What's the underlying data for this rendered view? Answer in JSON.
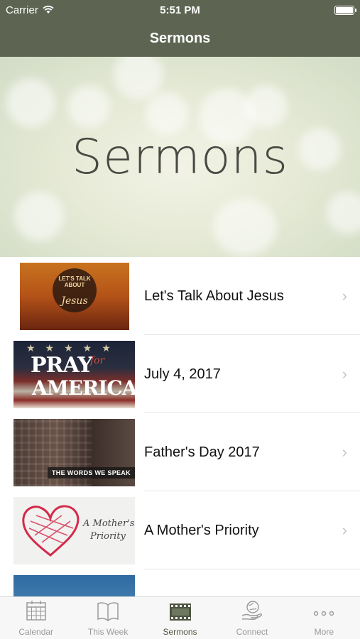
{
  "status_bar": {
    "carrier": "Carrier",
    "time": "5:51 PM"
  },
  "nav": {
    "title": "Sermons"
  },
  "banner": {
    "title": "Sermons"
  },
  "sermons": [
    {
      "title": "Let's Talk About Jesus",
      "thumb_text_1": "LET'S TALK ABOUT",
      "thumb_text_2": "Jesus"
    },
    {
      "title": "July 4, 2017",
      "thumb_text_1": "PRAY",
      "thumb_text_2": "for",
      "thumb_text_3": "AMERICA"
    },
    {
      "title": "Father's Day 2017",
      "thumb_text_1": "THE WORDS WE SPEAK"
    },
    {
      "title": "A Mother's Priority",
      "thumb_text_1": "A Mother's",
      "thumb_text_2": "Priority"
    }
  ],
  "tabs": [
    {
      "label": "Calendar",
      "icon": "calendar-icon",
      "active": false
    },
    {
      "label": "This Week",
      "icon": "book-icon",
      "active": false
    },
    {
      "label": "Sermons",
      "icon": "film-icon",
      "active": true
    },
    {
      "label": "Connect",
      "icon": "globe-hand-icon",
      "active": false
    },
    {
      "label": "More",
      "icon": "more-icon",
      "active": false
    }
  ],
  "colors": {
    "nav_bg": "#5d6451",
    "tab_active": "#4d5442",
    "tab_inactive": "#9a9a9a"
  }
}
